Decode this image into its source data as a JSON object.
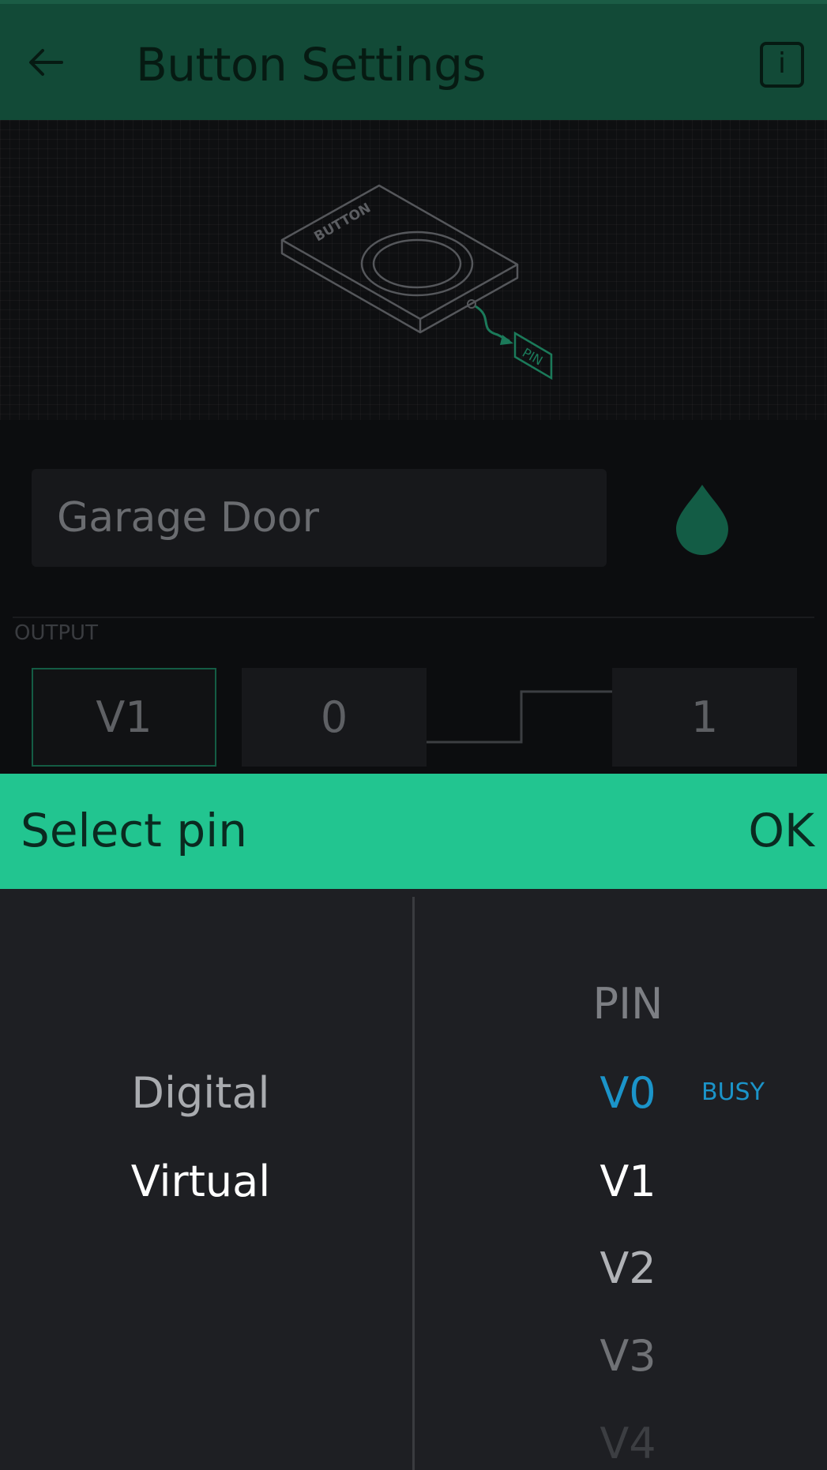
{
  "header": {
    "title": "Button Settings",
    "back_icon": "arrow-left-icon",
    "info_label": "i"
  },
  "illustration": {
    "device_label": "BUTTON",
    "pin_label": "PIN"
  },
  "widget": {
    "name": "Garage Door",
    "color": "#135c45"
  },
  "output": {
    "section_label": "OUTPUT",
    "pin": "V1",
    "low_value": "0",
    "high_value": "1"
  },
  "picker": {
    "title": "Select pin",
    "ok_label": "OK",
    "types": [
      "Digital",
      "Virtual"
    ],
    "selected_type": "Virtual",
    "pin_header": "PIN",
    "pins": [
      "V0",
      "V1",
      "V2",
      "V3",
      "V4"
    ],
    "selected_pin": "V1",
    "busy_label": "BUSY",
    "busy_pin": "V0",
    "accent_color": "#22c590",
    "busy_color": "#1b94c9"
  }
}
